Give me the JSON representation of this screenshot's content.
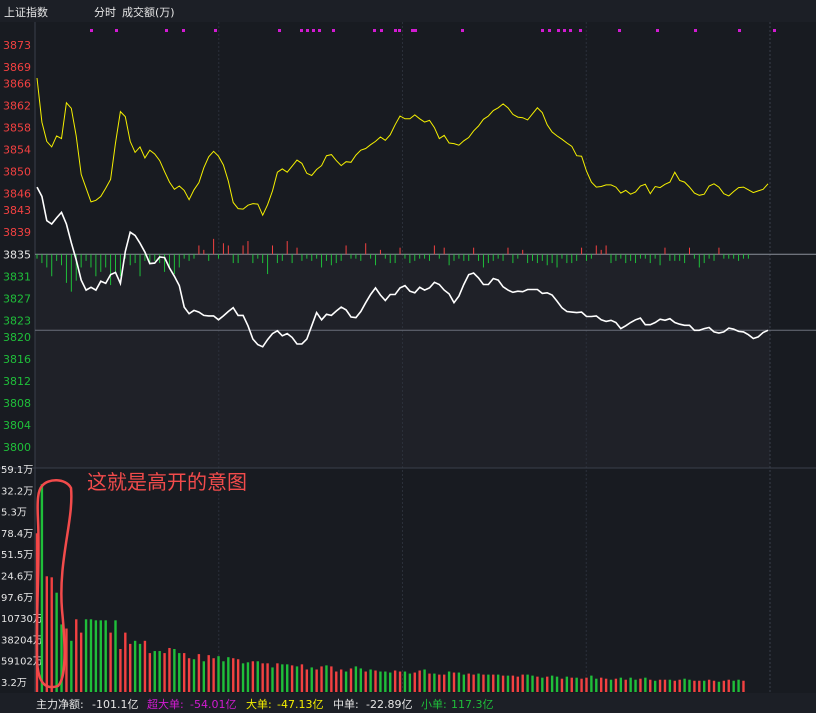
{
  "header": {
    "index_name": "上证指数",
    "mode": "分时",
    "indicator": "成交额(万)"
  },
  "chart_data": {
    "type": "line",
    "price_axis_labels_red": [
      "3873",
      "3869",
      "3866",
      "3862",
      "3858",
      "3854",
      "3850",
      "3846",
      "3843",
      "3839"
    ],
    "price_axis_label_mid": "3835",
    "price_axis_labels_green": [
      "3831",
      "3827",
      "3823",
      "3820",
      "3816",
      "3812",
      "3808",
      "3804",
      "3800"
    ],
    "volume_axis_labels": [
      "59.1万",
      "32.2万",
      "5.3万",
      "78.4万",
      "51.5万",
      "24.6万",
      "97.6万",
      "10730万",
      "38204万",
      "59102万",
      "3.2万"
    ],
    "prev_close": 3835,
    "series": [
      {
        "color": "#ffffff",
        "values": [
          3847.2,
          3845.5,
          3841.1,
          3840.5,
          3841.6,
          3842.6,
          3840.5,
          3837.1,
          3834,
          3830.3,
          3828.5,
          3829,
          3828.5,
          3830.1,
          3829.7,
          3831.3,
          3831.7,
          3829.7,
          3835.5,
          3839,
          3838.4,
          3837,
          3835.4,
          3833.3,
          3833.4,
          3834.5,
          3834.4,
          3832.5,
          3831,
          3829.3,
          3825.4,
          3824.2,
          3824.8,
          3824.5,
          3823.9,
          3823.8,
          3823.8,
          3823.1,
          3823.8,
          3824.6,
          3825.3,
          3823.9,
          3823.9,
          3822,
          3819.6,
          3818.6,
          3818.2,
          3819.5,
          3820.6,
          3821.1,
          3820.2,
          3820.6,
          3819.9,
          3818.7,
          3818.7,
          3819.6,
          3822,
          3824.4,
          3823.1,
          3824.1,
          3823.9,
          3824.7,
          3825.4,
          3824.9,
          3823.6,
          3823.5,
          3824.6,
          3826.2,
          3827.7,
          3828.9,
          3827.6,
          3826.6,
          3827.7,
          3827.7,
          3828.9,
          3829.3,
          3828.3,
          3828,
          3829,
          3828.5,
          3828.9,
          3829.9,
          3829.5,
          3828.5,
          3827.8,
          3826.2,
          3827.4,
          3829.5,
          3831.3,
          3831.6,
          3830.7,
          3829.5,
          3829.5,
          3830.6,
          3830.3,
          3829.1,
          3828.5,
          3828.1,
          3828.3,
          3828.2,
          3828.6,
          3828.6,
          3828.6,
          3827.9,
          3828,
          3827.6,
          3826.5,
          3825.3,
          3824.6,
          3824.5,
          3824.4,
          3824.5,
          3823.7,
          3823.7,
          3823.8,
          3823.1,
          3822.8,
          3823,
          3822.6,
          3821.5,
          3822,
          3822.6,
          3823.1,
          3823.4,
          3822.2,
          3822.2,
          3822.6,
          3823.2,
          3823,
          3823.3,
          3822.6,
          3822.3,
          3822.1,
          3822.1,
          3821.2,
          3821.2,
          3821.5,
          3821.7,
          3820.9,
          3820.7,
          3820.9,
          3821.6,
          3821.4,
          3821,
          3820.9,
          3820.4,
          3819.7,
          3820,
          3820.8,
          3821.2
        ],
        "values_note_removed": true
      },
      {
        "color": "#f5f000",
        "values": [
          3867,
          3859,
          3855.5,
          3854.5,
          3856.5,
          3856,
          3862.5,
          3861.5,
          3856.5,
          3849.5,
          3847,
          3844.5,
          3844.8,
          3845.5,
          3847,
          3848.6,
          3855.2,
          3860.9,
          3860,
          3855.5,
          3853.5,
          3854.5,
          3852.5,
          3853.9,
          3853.2,
          3852,
          3850,
          3848.1,
          3846.8,
          3847.4,
          3846.6,
          3844.9,
          3846.7,
          3848,
          3850.7,
          3852.7,
          3853.7,
          3852.8,
          3851.2,
          3848.3,
          3844.4,
          3843.3,
          3843.2,
          3843.9,
          3844.2,
          3844.1,
          3842.1,
          3844,
          3846.5,
          3849.9,
          3850.5,
          3849.9,
          3851,
          3852.1,
          3851.5,
          3849.7,
          3849.3,
          3850.4,
          3851.1,
          3852.9,
          3853.1,
          3852,
          3851.1,
          3851.8,
          3851.7,
          3853,
          3853.9,
          3854.2,
          3854.9,
          3855.5,
          3856.3,
          3855.7,
          3856.7,
          3858.5,
          3860.1,
          3859.6,
          3859.6,
          3860.3,
          3859.6,
          3859,
          3859.3,
          3858,
          3856,
          3856.6,
          3855.2,
          3855.1,
          3854.8,
          3855.6,
          3856.2,
          3857.4,
          3858.3,
          3859.5,
          3860.1,
          3861.1,
          3861.6,
          3862.3,
          3861.6,
          3860.4,
          3859.9,
          3859.8,
          3859.4,
          3860.5,
          3861.6,
          3860.7,
          3858.5,
          3857.2,
          3856.5,
          3855.9,
          3855.2,
          3854.6,
          3852.9,
          3852.8,
          3850.1,
          3848.1,
          3847.2,
          3847.3,
          3847.6,
          3847.6,
          3847.2,
          3846.1,
          3846.6,
          3845.9,
          3846.3,
          3847.4,
          3847.7,
          3846,
          3847.3,
          3847.1,
          3847.7,
          3848.1,
          3849.9,
          3848.4,
          3848.1,
          3847.2,
          3846.1,
          3845.7,
          3845.9,
          3847.4,
          3847.8,
          3847.2,
          3846,
          3845.6,
          3846.4,
          3847.1,
          3847.2,
          3846.7,
          3846.2,
          3846.5,
          3846.8,
          3847.8
        ]
      }
    ],
    "net_flow_bars": [
      -2,
      -4,
      -6,
      -10,
      -3,
      -5,
      -13,
      -17,
      -12,
      -6,
      -3,
      -6,
      -10,
      -8,
      -6,
      -14,
      -8,
      -10,
      -2,
      -5,
      -4,
      -10,
      -3,
      -4,
      -3,
      -4,
      -8,
      -6,
      -9,
      -6,
      -2,
      -3,
      -2,
      4,
      2,
      -3,
      7,
      -2,
      5,
      4,
      -4,
      -4,
      4,
      6,
      -4,
      -2,
      -4,
      -9,
      4,
      -4,
      -3,
      6,
      -4,
      3,
      -3,
      -2,
      -3,
      -2,
      -6,
      -3,
      -5,
      -4,
      -3,
      4,
      -2,
      -2,
      -3,
      5,
      -2,
      -5,
      2,
      -2,
      -4,
      -4,
      3,
      -2,
      -4,
      -3,
      -2,
      -2,
      -3,
      4,
      -2,
      3,
      -5,
      -3,
      -2,
      -3,
      -3,
      3,
      -3,
      -6,
      -4,
      -3,
      -2,
      -3,
      3,
      -4,
      -2,
      2,
      -4,
      -3,
      -4,
      -3,
      -5,
      -4,
      -6,
      -2,
      -4,
      -4,
      -3,
      3,
      -3,
      -2,
      4,
      2,
      4,
      -4,
      -3,
      -2,
      -4,
      -3,
      -4,
      -2,
      -2,
      -4,
      -2,
      -5,
      3,
      -3,
      -3,
      -3,
      -4,
      3,
      -2,
      -6,
      -4,
      -2,
      -3,
      3,
      -2,
      -2,
      -2,
      -3,
      -2,
      -2
    ],
    "volume_bars": [
      155,
      203,
      113,
      112,
      97,
      66,
      62,
      50,
      71,
      58,
      71,
      71,
      70,
      70,
      70,
      58,
      70,
      42,
      58,
      47,
      50,
      47,
      50,
      38,
      40,
      40,
      38,
      43,
      42,
      38,
      38,
      33,
      32,
      37,
      30,
      36,
      33,
      35,
      30,
      34,
      33,
      32,
      28,
      29,
      30,
      30,
      28,
      28,
      24,
      28,
      27,
      27,
      26,
      25,
      27,
      22,
      24,
      22,
      25,
      26,
      25,
      20,
      22,
      20,
      23,
      25,
      23,
      20,
      22,
      21,
      20,
      20,
      19,
      21,
      20,
      20,
      18,
      19,
      21,
      22,
      18,
      18,
      17,
      17,
      20,
      19,
      19,
      17,
      18,
      17,
      18,
      17,
      17,
      17,
      17,
      16,
      16,
      16,
      15,
      17,
      17,
      16,
      15,
      14,
      15,
      16,
      15,
      13,
      15,
      14,
      14,
      13,
      14,
      16,
      13,
      14,
      13,
      12,
      13,
      14,
      12,
      14,
      12,
      13,
      14,
      12,
      11,
      12,
      12,
      12,
      11,
      12,
      13,
      12,
      11,
      11,
      11,
      12,
      11,
      10,
      11,
      12,
      11,
      12,
      11
    ],
    "volume_up": [
      true,
      false,
      true,
      true,
      false,
      false,
      true,
      false,
      true,
      true,
      false,
      false,
      false,
      false,
      false,
      true,
      false,
      true,
      true,
      true,
      false,
      false,
      true,
      true,
      false,
      false,
      true,
      true,
      false,
      false,
      true,
      true,
      false,
      true,
      false,
      true,
      true,
      false,
      false,
      false,
      true,
      true,
      false,
      false,
      true,
      false,
      true,
      true,
      false,
      true,
      false,
      false,
      true,
      false,
      true,
      true,
      false,
      true,
      true,
      false,
      true,
      true,
      true,
      false,
      true,
      false,
      false,
      true,
      false,
      true,
      false,
      false,
      false,
      true,
      true,
      false,
      false,
      true,
      true,
      false,
      true,
      false,
      true,
      true,
      false,
      true,
      false,
      false,
      true,
      true,
      false,
      true,
      false,
      true,
      false,
      true,
      false,
      true,
      true,
      true,
      false,
      false,
      true,
      false,
      true,
      false,
      false,
      true,
      false,
      true,
      false,
      true,
      true,
      false,
      false,
      true,
      true,
      false,
      true,
      false,
      true,
      false,
      false,
      true,
      false,
      true,
      false,
      true,
      true,
      false,
      true,
      true,
      false,
      false,
      true,
      true,
      false,
      true,
      true,
      false,
      true,
      true,
      false,
      false,
      true,
      true,
      false,
      true
    ]
  },
  "annotation": {
    "text": "这就是高开的意图",
    "color": "#f24b4b"
  },
  "footer": {
    "main_net_label": "主力净额:",
    "main_net_value": "-101.1亿",
    "super_large_label": "超大单:",
    "super_large_value": "-54.01亿",
    "large_label": "大单:",
    "large_value": "-47.13亿",
    "medium_label": "中单:",
    "medium_value": "-22.89亿",
    "small_label": "小单:",
    "small_value": "117.3亿"
  },
  "colors": {
    "up": "#f34141",
    "down": "#1fbf3a",
    "background": "#181b21",
    "grid": "#2b303a",
    "white_line": "#ffffff",
    "yellow_line": "#f5f000",
    "signal_dots": "#d21bd2"
  }
}
